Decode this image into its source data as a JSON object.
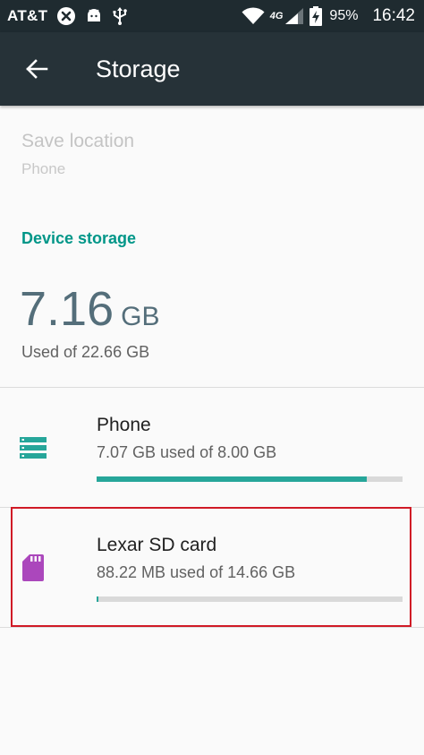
{
  "status_bar": {
    "carrier": "AT&T",
    "network_type": "4G",
    "battery_percent": "95%",
    "time": "16:42",
    "icons": [
      "no-sim-x-icon",
      "android-icon",
      "usb-icon",
      "wifi-icon",
      "signal-icon",
      "battery-charging-icon"
    ]
  },
  "app_bar": {
    "title": "Storage",
    "back_icon": "arrow-left-icon"
  },
  "save_location": {
    "title": "Save location",
    "value": "Phone"
  },
  "device_storage": {
    "header": "Device storage",
    "used_value": "7.16",
    "used_unit": "GB",
    "used_caption": "Used of 22.66 GB"
  },
  "volumes": [
    {
      "title": "Phone",
      "summary": "7.07 GB used of 8.00 GB",
      "icon": "storage-icon",
      "icon_color": "#26a69a",
      "usage_fraction": 0.884
    },
    {
      "title": "Lexar SD card",
      "summary": "88.22 MB used of 14.66 GB",
      "icon": "sd-card-icon",
      "icon_color": "#ab47bc",
      "usage_fraction": 0.006
    }
  ],
  "colors": {
    "status_bar": "#1f2b30",
    "app_bar": "#263238",
    "accent": "#009688",
    "progress": "#26a69a",
    "highlight": "#d01a26"
  }
}
